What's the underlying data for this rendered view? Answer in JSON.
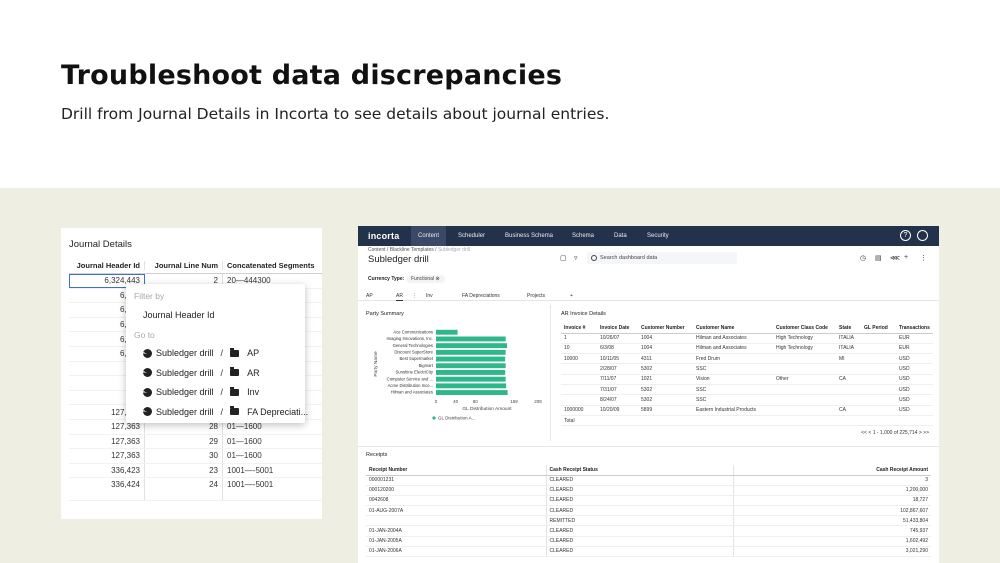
{
  "hero": {
    "title": "Troubleshoot data discrepancies",
    "subtitle": "Drill from Journal Details in Incorta to see details about journal entries."
  },
  "journal": {
    "title": "Journal Details",
    "headers": [
      "Journal Header Id",
      "Journal  Line Num",
      "Concatenated Segments"
    ],
    "rows": [
      [
        "6,324,443",
        "2",
        "20—444300"
      ],
      [
        "6,324",
        "",
        ""
      ],
      [
        "6,324",
        "",
        ""
      ],
      [
        "6,324",
        "",
        ""
      ],
      [
        "6,324",
        "",
        ""
      ],
      [
        "6,324",
        "",
        ""
      ],
      [
        "127",
        "",
        ""
      ],
      [
        "127",
        "",
        ""
      ],
      [
        "127",
        "",
        ""
      ],
      [
        "127,363",
        "27",
        "01—1600"
      ],
      [
        "127,363",
        "28",
        "01—1600"
      ],
      [
        "127,363",
        "29",
        "01—1600"
      ],
      [
        "127,363",
        "30",
        "01—1600"
      ],
      [
        "336,423",
        "23",
        "1001—-5001"
      ],
      [
        "336,424",
        "24",
        "1001—-5001"
      ]
    ]
  },
  "context_menu": {
    "filter_by": "Filter by",
    "filter_item": "Journal Header Id",
    "go_to": "Go to",
    "drill_label": "Subledger drill",
    "targets": [
      "AP",
      "AR",
      "Inv",
      "FA Depreciati..."
    ]
  },
  "app": {
    "logo": "incorta",
    "nav_tabs": [
      "Content",
      "Scheduler",
      "Business Schema",
      "Schema",
      "Data",
      "Security"
    ],
    "help_icon": "?",
    "breadcrumb": [
      "Content",
      "Blackline Templates",
      "Subledger drill"
    ],
    "title": "Subledger drill",
    "search_placeholder": "Search dashboard data",
    "filter_label": "Currency Type:",
    "filter_value": "Functional",
    "dash_tabs": [
      "AP",
      "AR",
      "Inv",
      "FA Depreciations",
      "Projects",
      "+"
    ],
    "party_summary": {
      "title": "Party Summary",
      "y_axis_label": "Party Name",
      "x_axis_label": "GL Distribution Amount",
      "legend": "GL Distribution A...",
      "bar_color": "#2eb88a"
    },
    "ar_invoice": {
      "title": "AR Invoice Details",
      "headers": [
        "Invoice #",
        "Invoice Date",
        "Customer Number",
        "Customer Name",
        "Customer Class Code",
        "State",
        "GL Period",
        "Transactions"
      ],
      "rows": [
        [
          "1",
          "10/26/07",
          "1004",
          "Hilman and Associates",
          "High Technology",
          "ITALIA",
          "",
          "EUR"
        ],
        [
          "10",
          "6/3/08",
          "1004",
          "Hilman and Associates",
          "High Technology",
          "ITALIA",
          "",
          "EUR"
        ],
        [
          "10000",
          "10/11/05",
          "4311",
          "Fred Drum",
          "",
          "MI",
          "",
          "USD"
        ],
        [
          "",
          "2/28/07",
          "5302",
          "SSC",
          "",
          "",
          "",
          "USD"
        ],
        [
          "",
          "7/11/07",
          "1021",
          "Vision",
          "Other",
          "CA",
          "",
          "USD"
        ],
        [
          "",
          "7/31/07",
          "5302",
          "SSC",
          "",
          "",
          "",
          "USD"
        ],
        [
          "",
          "8/24/07",
          "5302",
          "SSC",
          "",
          "",
          "",
          "USD"
        ],
        [
          "1000000",
          "10/20/09",
          "5899",
          "Eastern Industrial Products",
          "",
          "CA",
          "",
          "USD"
        ],
        [
          "Total",
          "",
          "",
          "",
          "",
          "",
          "",
          ""
        ]
      ],
      "pager": "1 - 1,000 of 225,714"
    },
    "receipts": {
      "title": "Receipts",
      "headers": [
        "Receipt Number",
        "Cash Receipt Status",
        "Cash Receipt Amount"
      ],
      "rows": [
        [
          "000001231",
          "CLEARED",
          "3"
        ],
        [
          "000120200",
          "CLEARED",
          "1,200,000"
        ],
        [
          "0042608",
          "CLEARED",
          "18,727"
        ],
        [
          "01-AUG-2007A",
          "CLEARED",
          "102,867,607"
        ],
        [
          "",
          "REMITTED",
          "51,433,804"
        ],
        [
          "01-JAN-2004A",
          "CLEARED",
          "745,937"
        ],
        [
          "01-JAN-2005A",
          "CLEARED",
          "1,602,492"
        ],
        [
          "01-JAN-2006A",
          "CLEARED",
          "3,021,290"
        ]
      ]
    }
  },
  "chart_data": {
    "type": "bar",
    "orientation": "horizontal",
    "categories": [
      "Ace Communications",
      "Imaging Innovations, Inc.",
      "General Technologies",
      "Discount SuperStore",
      "Best Supermarket",
      "Bigmart",
      "Sunshine ElectriCity",
      "Computer Service and ...",
      "Acme Distribution Inco...",
      "Hilman and Associates"
    ],
    "series": [
      {
        "name": "GL Distribution A...",
        "values": [
          44,
          142,
          145,
          142,
          141,
          142,
          141,
          142,
          143,
          146
        ]
      }
    ],
    "xticks": [
      "0",
      "40",
      "80",
      "159",
      "208"
    ],
    "xlim": [
      0,
      208
    ],
    "xlabel": "GL Distribution Amount",
    "ylabel": "Party Name",
    "grid": false,
    "legend": "bottom"
  }
}
